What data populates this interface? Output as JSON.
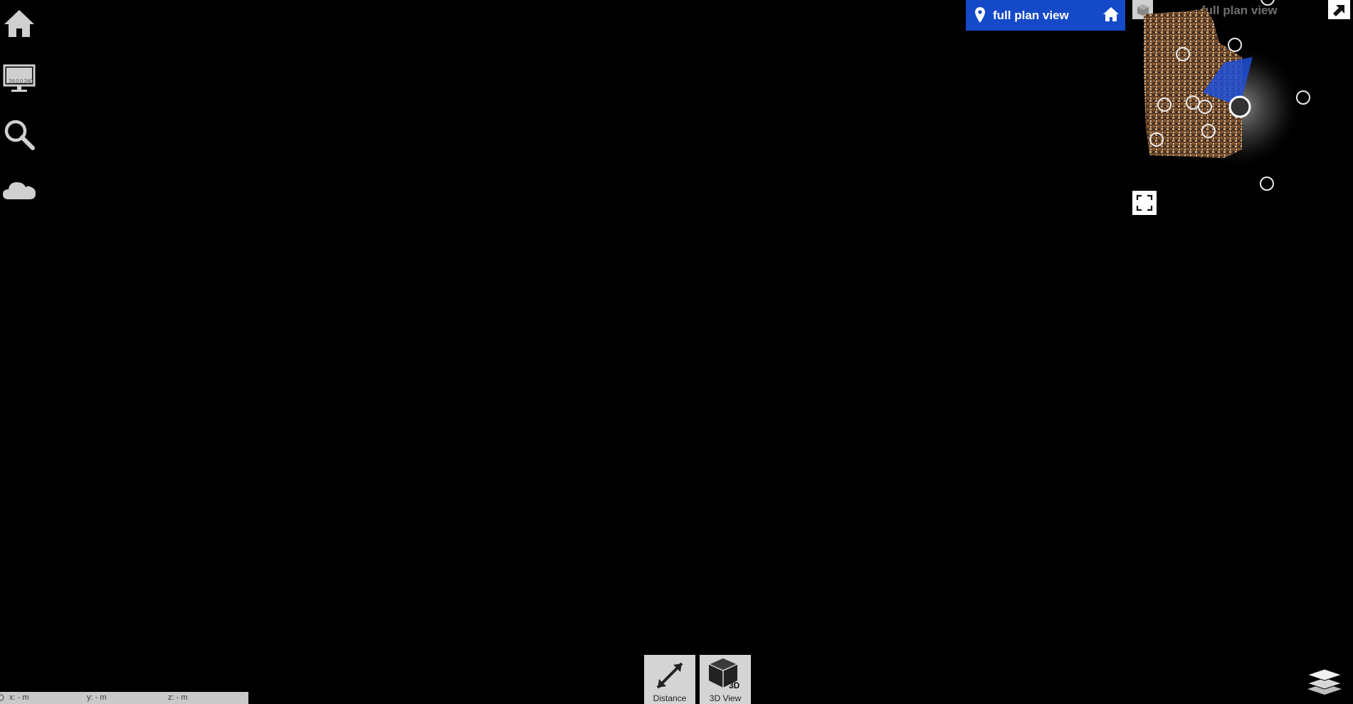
{
  "sidebar": {
    "ip_label": "24.0.0.240"
  },
  "minimap": {
    "plan_label": "full plan view",
    "ghost_label": "full plan view"
  },
  "tools": {
    "distance_label": "Distance",
    "view3d_label": "3D View",
    "view3d_badge": "3D"
  },
  "coords": {
    "x": "x:  - m",
    "y": "y:  - m",
    "z": "z:  - m"
  },
  "colors": {
    "accent": "#1449c8",
    "sidebar_icon": "#d0d0d0",
    "tool_bg": "#d4d4d4"
  }
}
